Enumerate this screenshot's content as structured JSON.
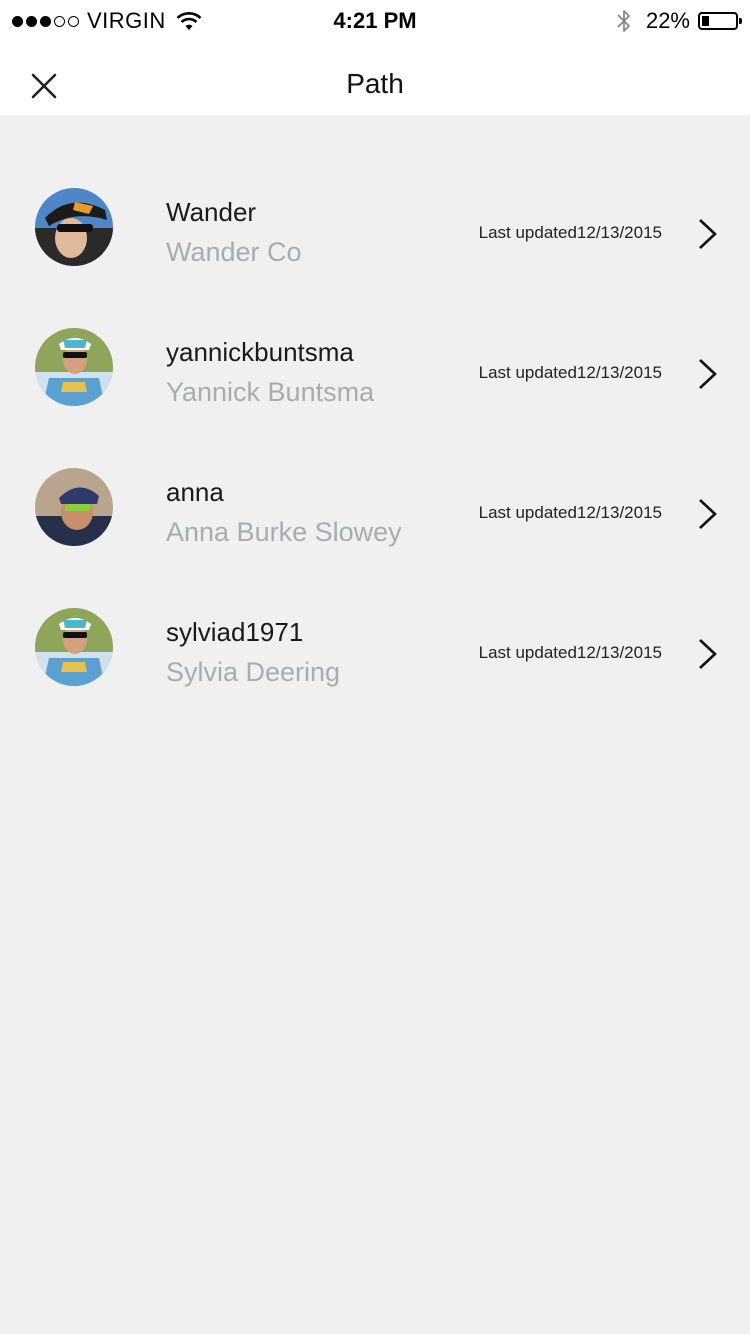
{
  "status_bar": {
    "carrier": "VIRGIN",
    "time": "4:21 PM",
    "battery_percent": "22%",
    "battery_level": 0.22,
    "signal_filled": 3,
    "signal_total": 5
  },
  "nav": {
    "title": "Path",
    "close_icon": "close-icon"
  },
  "items": [
    {
      "username": "Wander",
      "fullname": "Wander Co",
      "updated": "Last updated12/13/2015"
    },
    {
      "username": "yannickbuntsma",
      "fullname": "Yannick Buntsma",
      "updated": "Last updated12/13/2015"
    },
    {
      "username": "anna",
      "fullname": "Anna Burke Slowey",
      "updated": "Last updated12/13/2015"
    },
    {
      "username": "sylviad1971",
      "fullname": "Sylvia Deering",
      "updated": "Last updated12/13/2015"
    }
  ],
  "colors": {
    "background": "#f0f0f0",
    "bar_background": "#ffffff",
    "secondary_text": "#a6adaf"
  }
}
